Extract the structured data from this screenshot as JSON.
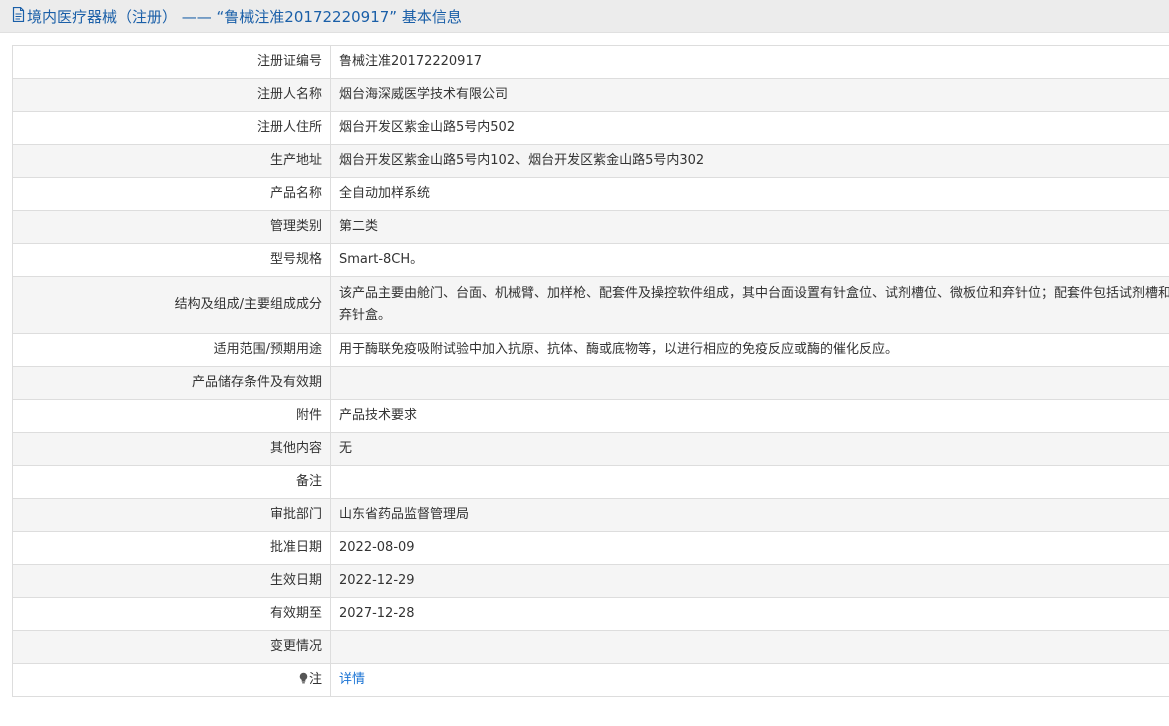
{
  "header": {
    "title": "境内医疗器械（注册） ——  “鲁械注准20172220917” 基本信息"
  },
  "rows": [
    {
      "label": "注册证编号",
      "value": "鲁械注准20172220917"
    },
    {
      "label": "注册人名称",
      "value": "烟台海深威医学技术有限公司"
    },
    {
      "label": "注册人住所",
      "value": "烟台开发区紫金山路5号内502"
    },
    {
      "label": "生产地址",
      "value": "烟台开发区紫金山路5号内102、烟台开发区紫金山路5号内302"
    },
    {
      "label": "产品名称",
      "value": "全自动加样系统"
    },
    {
      "label": "管理类别",
      "value": "第二类"
    },
    {
      "label": "型号规格",
      "value": "Smart-8CH。"
    },
    {
      "label": "结构及组成/主要组成成分",
      "value": "该产品主要由舱门、台面、机械臂、加样枪、配套件及操控软件组成，其中台面设置有针盒位、试剂槽位、微板位和弃针位；配套件包括试剂槽和弃针盒。"
    },
    {
      "label": "适用范围/预期用途",
      "value": "用于酶联免疫吸附试验中加入抗原、抗体、酶或底物等，以进行相应的免疫反应或酶的催化反应。"
    },
    {
      "label": "产品储存条件及有效期",
      "value": ""
    },
    {
      "label": "附件",
      "value": "产品技术要求"
    },
    {
      "label": "其他内容",
      "value": "无"
    },
    {
      "label": "备注",
      "value": ""
    },
    {
      "label": "审批部门",
      "value": "山东省药品监督管理局"
    },
    {
      "label": "批准日期",
      "value": "2022-08-09"
    },
    {
      "label": "生效日期",
      "value": "2022-12-29"
    },
    {
      "label": "有效期至",
      "value": "2027-12-28"
    },
    {
      "label": "变更情况",
      "value": ""
    },
    {
      "label": "注",
      "value": "详情"
    }
  ],
  "icons": {
    "header": "document-icon",
    "note": "lightbulb-icon"
  },
  "colors": {
    "header_text": "#1a5fa8",
    "link": "#1a73d4",
    "stripe": "#f5f5f5",
    "border": "#dddddd"
  }
}
